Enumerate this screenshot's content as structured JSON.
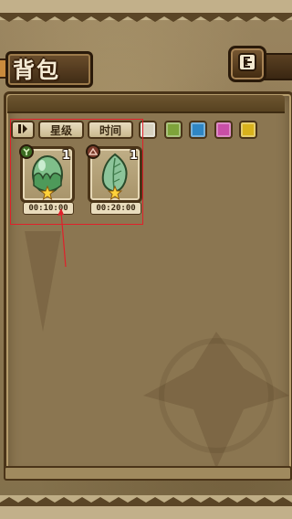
{
  "header": {
    "title": "背包"
  },
  "toolbar": {
    "star_sort_label": "星级",
    "time_sort_label": "时间",
    "filters": [
      {
        "name": "filter-white",
        "color": "#d8d2c0"
      },
      {
        "name": "filter-green",
        "color": "#7ea33a"
      },
      {
        "name": "filter-blue",
        "color": "#2f86c4"
      },
      {
        "name": "filter-pink",
        "color": "#c94fa6"
      },
      {
        "name": "filter-yellow",
        "color": "#d9b21c"
      }
    ]
  },
  "items": [
    {
      "count": "1",
      "timer": "00:10:00",
      "stars": 1,
      "type_icon": "leaf-icon",
      "art": "green-egg",
      "badge_color": "#3c6b22"
    },
    {
      "count": "1",
      "timer": "00:20:00",
      "stars": 1,
      "type_icon": "mountain-icon",
      "art": "leaf-egg",
      "badge_color": "#7a3a2a"
    }
  ],
  "colors": {
    "accent": "#e0202a",
    "panel": "#8b7651",
    "wood": "#4a3418"
  }
}
